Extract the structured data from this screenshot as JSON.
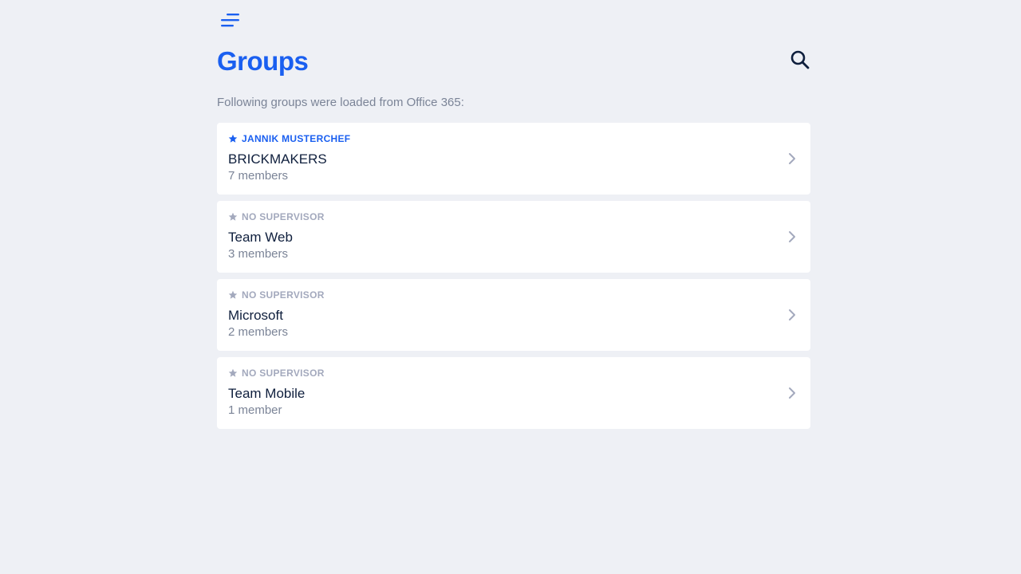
{
  "colors": {
    "accent": "#1a5ff0",
    "muted": "#a3a9bd",
    "text": "#0f1f3d",
    "subtext": "#7b8497",
    "background": "#eef0f5",
    "card": "#ffffff"
  },
  "header": {
    "menu_icon": "menu-icon",
    "title": "Groups",
    "search_icon": "search-icon"
  },
  "subtitle": "Following groups were loaded from Office 365:",
  "groups": [
    {
      "supervisor": "JANNIK MUSTERCHEF",
      "has_supervisor": true,
      "name": "BRICKMAKERS",
      "members": "7 members"
    },
    {
      "supervisor": "NO SUPERVISOR",
      "has_supervisor": false,
      "name": "Team Web",
      "members": "3 members"
    },
    {
      "supervisor": "NO SUPERVISOR",
      "has_supervisor": false,
      "name": "Microsoft",
      "members": "2 members"
    },
    {
      "supervisor": "NO SUPERVISOR",
      "has_supervisor": false,
      "name": "Team Mobile",
      "members": "1 member"
    }
  ]
}
